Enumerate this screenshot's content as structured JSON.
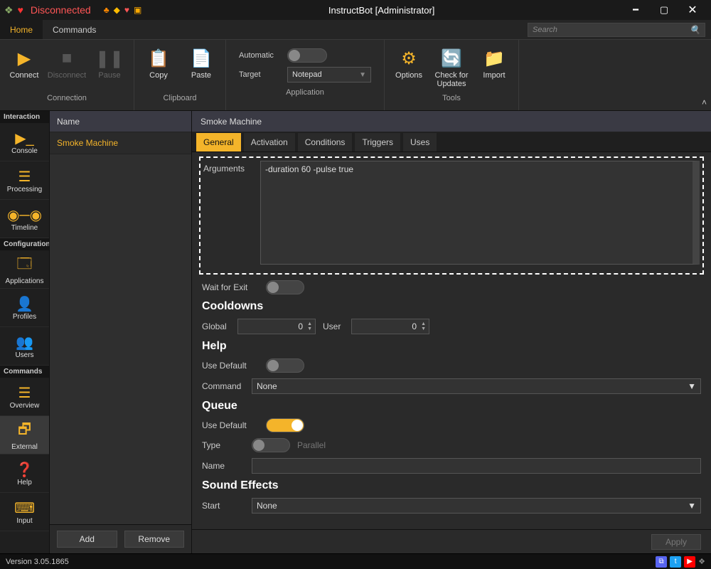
{
  "titlebar": {
    "status": "Disconnected",
    "title": "InstructBot [Administrator]"
  },
  "menu": {
    "home": "Home",
    "commands": "Commands",
    "search_placeholder": "Search"
  },
  "ribbon": {
    "connect": "Connect",
    "disconnect": "Disconnect",
    "pause": "Pause",
    "group_connection": "Connection",
    "copy": "Copy",
    "paste": "Paste",
    "group_clipboard": "Clipboard",
    "automatic": "Automatic",
    "target": "Target",
    "target_value": "Notepad",
    "group_application": "Application",
    "options": "Options",
    "check": "Check for\nUpdates",
    "import": "Import",
    "group_tools": "Tools"
  },
  "sidebar": {
    "interaction": "Interaction",
    "console": "Console",
    "processing": "Processing",
    "timeline": "Timeline",
    "configuration": "Configuration",
    "applications": "Applications",
    "profiles": "Profiles",
    "users": "Users",
    "commands": "Commands",
    "overview": "Overview",
    "external": "External",
    "help": "Help",
    "input": "Input"
  },
  "list": {
    "header": "Name",
    "item0": "Smoke Machine",
    "add": "Add",
    "remove": "Remove"
  },
  "details": {
    "title": "Smoke Machine",
    "tabs": {
      "general": "General",
      "activation": "Activation",
      "conditions": "Conditions",
      "triggers": "Triggers",
      "uses": "Uses"
    },
    "arguments_label": "Arguments",
    "arguments_value": "-duration 60 -pulse true",
    "wait_label": "Wait for Exit",
    "cooldowns_h": "Cooldowns",
    "global_label": "Global",
    "global_value": "0",
    "user_label": "User",
    "user_value": "0",
    "help_h": "Help",
    "use_default_label": "Use Default",
    "command_label": "Command",
    "command_value": "None",
    "queue_h": "Queue",
    "type_label": "Type",
    "type_value": "Parallel",
    "name_label": "Name",
    "name_value": "",
    "sfx_h": "Sound Effects",
    "start_label": "Start",
    "start_value": "None",
    "apply": "Apply"
  },
  "status": {
    "version": "Version 3.05.1865"
  }
}
